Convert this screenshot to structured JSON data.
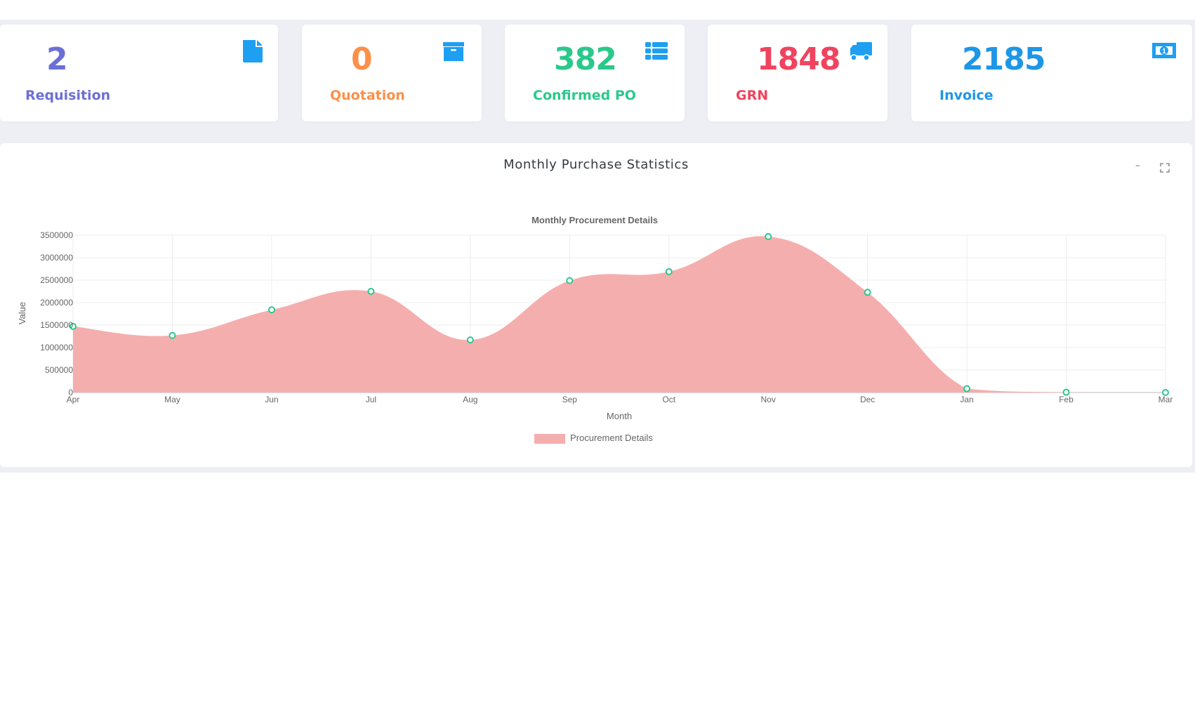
{
  "cards": [
    {
      "value": "2",
      "label": "Requisition",
      "icon": "file-icon",
      "color": "#6c6fd6"
    },
    {
      "value": "0",
      "label": "Quotation",
      "icon": "archive-box-icon",
      "color": "#fd8f48"
    },
    {
      "value": "382",
      "label": "Confirmed PO",
      "icon": "list-icon",
      "color": "#2ac98b"
    },
    {
      "value": "1848",
      "label": "GRN",
      "icon": "truck-icon",
      "color": "#f0435f"
    },
    {
      "value": "2185",
      "label": "Invoice",
      "icon": "money-bill-icon",
      "color": "#1e96e6"
    }
  ],
  "icon_color": "#1e9ff2",
  "panel": {
    "title": "Monthly Purchase Statistics",
    "minimize_label": "–",
    "expand_label": "⛶"
  },
  "chart_data": {
    "type": "area",
    "title": "Monthly Procurement Details",
    "xlabel": "Month",
    "ylabel": "Value",
    "categories": [
      "Apr",
      "May",
      "Jun",
      "Jul",
      "Aug",
      "Sep",
      "Oct",
      "Nov",
      "Dec",
      "Jan",
      "Feb",
      "Mar"
    ],
    "series": [
      {
        "name": "Procurement Details",
        "values": [
          1470000,
          1270000,
          1840000,
          2250000,
          1170000,
          2490000,
          2690000,
          3470000,
          2230000,
          85000,
          5000,
          0
        ],
        "fill_color": "#f5aeae",
        "point_border_color": "#2ac98b"
      }
    ],
    "ylim": [
      0,
      3500000
    ],
    "yticks": [
      "0",
      "500000",
      "1000000",
      "1500000",
      "2000000",
      "2500000",
      "3000000",
      "3500000"
    ],
    "grid": true,
    "legend": "bottom-center",
    "smooth": true
  }
}
